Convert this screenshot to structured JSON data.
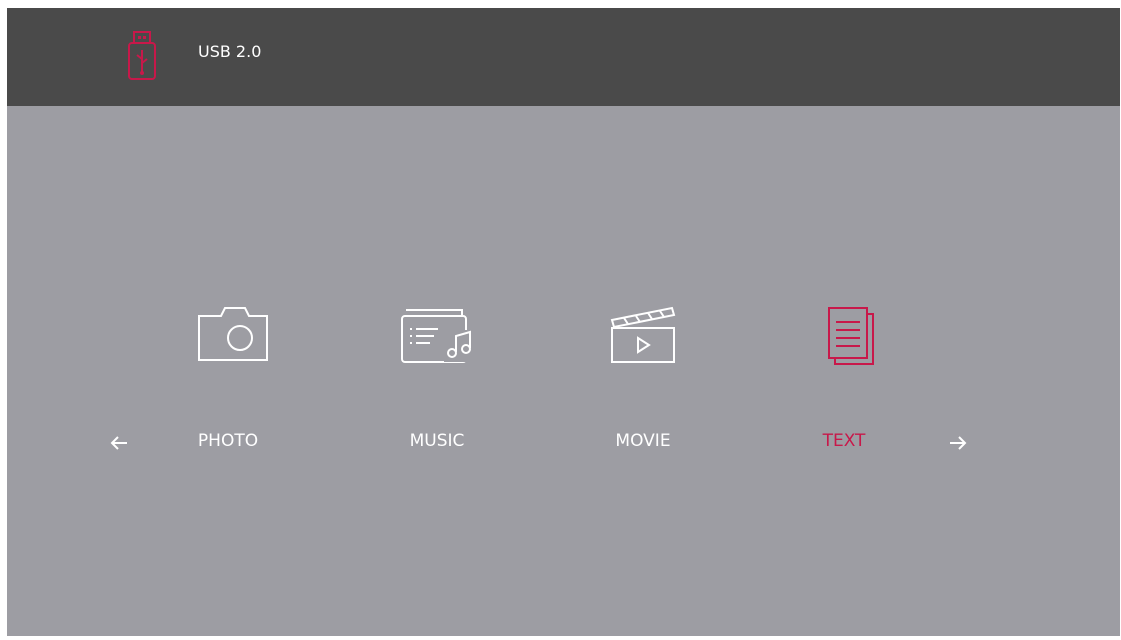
{
  "header": {
    "device_name": "USB 2.0",
    "device_icon": "usb-drive-icon"
  },
  "menu": {
    "items": [
      {
        "label": "PHOTO",
        "icon": "camera-icon",
        "selected": false
      },
      {
        "label": "MUSIC",
        "icon": "music-folder-icon",
        "selected": false
      },
      {
        "label": "MOVIE",
        "icon": "clapperboard-icon",
        "selected": false
      },
      {
        "label": "TEXT",
        "icon": "document-icon",
        "selected": true
      }
    ],
    "prev_icon": "arrow-left-icon",
    "next_icon": "arrow-right-icon"
  },
  "colors": {
    "accent": "#c8184a",
    "header_bg": "#4a4a4a",
    "background": "#9d9da3",
    "text": "#ffffff"
  }
}
